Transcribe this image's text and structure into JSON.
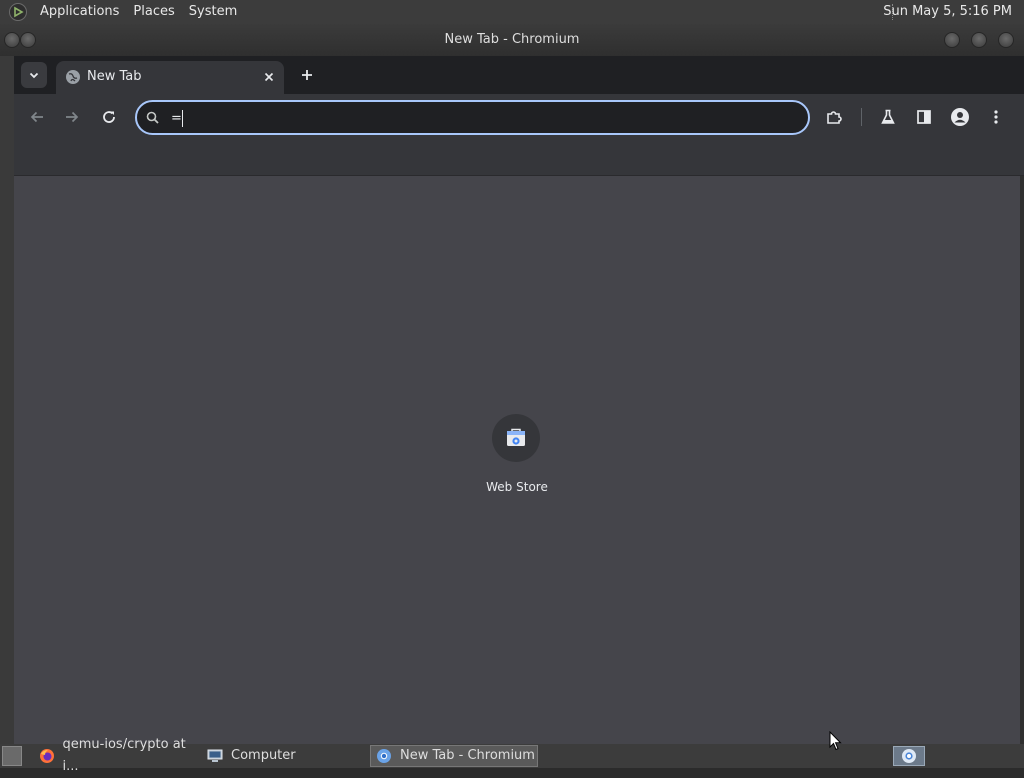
{
  "top_panel": {
    "menus": [
      "Applications",
      "Places",
      "System"
    ],
    "clock": "Sun May  5,  5:16 PM"
  },
  "window": {
    "title": "New Tab - Chromium"
  },
  "browser": {
    "tab": {
      "title": "New Tab",
      "icon": "globe-icon"
    },
    "omnibox": {
      "value": "="
    },
    "toolbar_icons": [
      "back-icon",
      "forward-icon",
      "reload-icon",
      "search-icon",
      "extensions-icon",
      "labs-icon",
      "side-panel-icon",
      "profile-icon",
      "more-menu-icon"
    ]
  },
  "new_tab_page": {
    "shortcuts": [
      {
        "label": "Web Store",
        "icon": "web-store-icon"
      }
    ]
  },
  "taskbar": {
    "tasks": [
      {
        "label": "qemu-ios/crypto at i...",
        "icon": "firefox-icon"
      },
      {
        "label": "Computer",
        "icon": "computer-icon"
      },
      {
        "label": "New Tab - Chromium",
        "icon": "chromium-icon"
      }
    ]
  },
  "colors": {
    "panel_bg": "#3c3c3c",
    "tabstrip_bg": "#1f2023",
    "toolbar_bg": "#35363a",
    "content_bg": "#45454b",
    "omnibox_focus": "#a8c7fa"
  }
}
